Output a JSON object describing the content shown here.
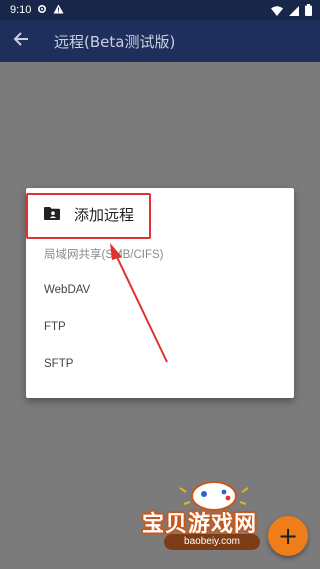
{
  "status_bar": {
    "time": "9:10"
  },
  "app_bar": {
    "title": "远程(Beta测试版)"
  },
  "menu": {
    "header_label": "添加远程",
    "items": [
      {
        "label": "局域网共享(SMB/CIFS)"
      },
      {
        "label": "WebDAV"
      },
      {
        "label": "FTP"
      },
      {
        "label": "SFTP"
      }
    ]
  },
  "fab": {
    "label": "+"
  },
  "watermark": {
    "title": "宝贝游戏网",
    "url": "baobeiy.com"
  },
  "colors": {
    "status_bar": "#18264a",
    "app_bar": "#1d2f5a",
    "scrim": "#7b7b7b",
    "highlight": "#e03030",
    "fab": "#ee7d1a"
  },
  "icons": {
    "status": [
      "settings-icon",
      "warning-icon",
      "wifi-icon",
      "battery-icon"
    ],
    "back": "arrow-left-icon",
    "header": "folder-person-icon"
  }
}
